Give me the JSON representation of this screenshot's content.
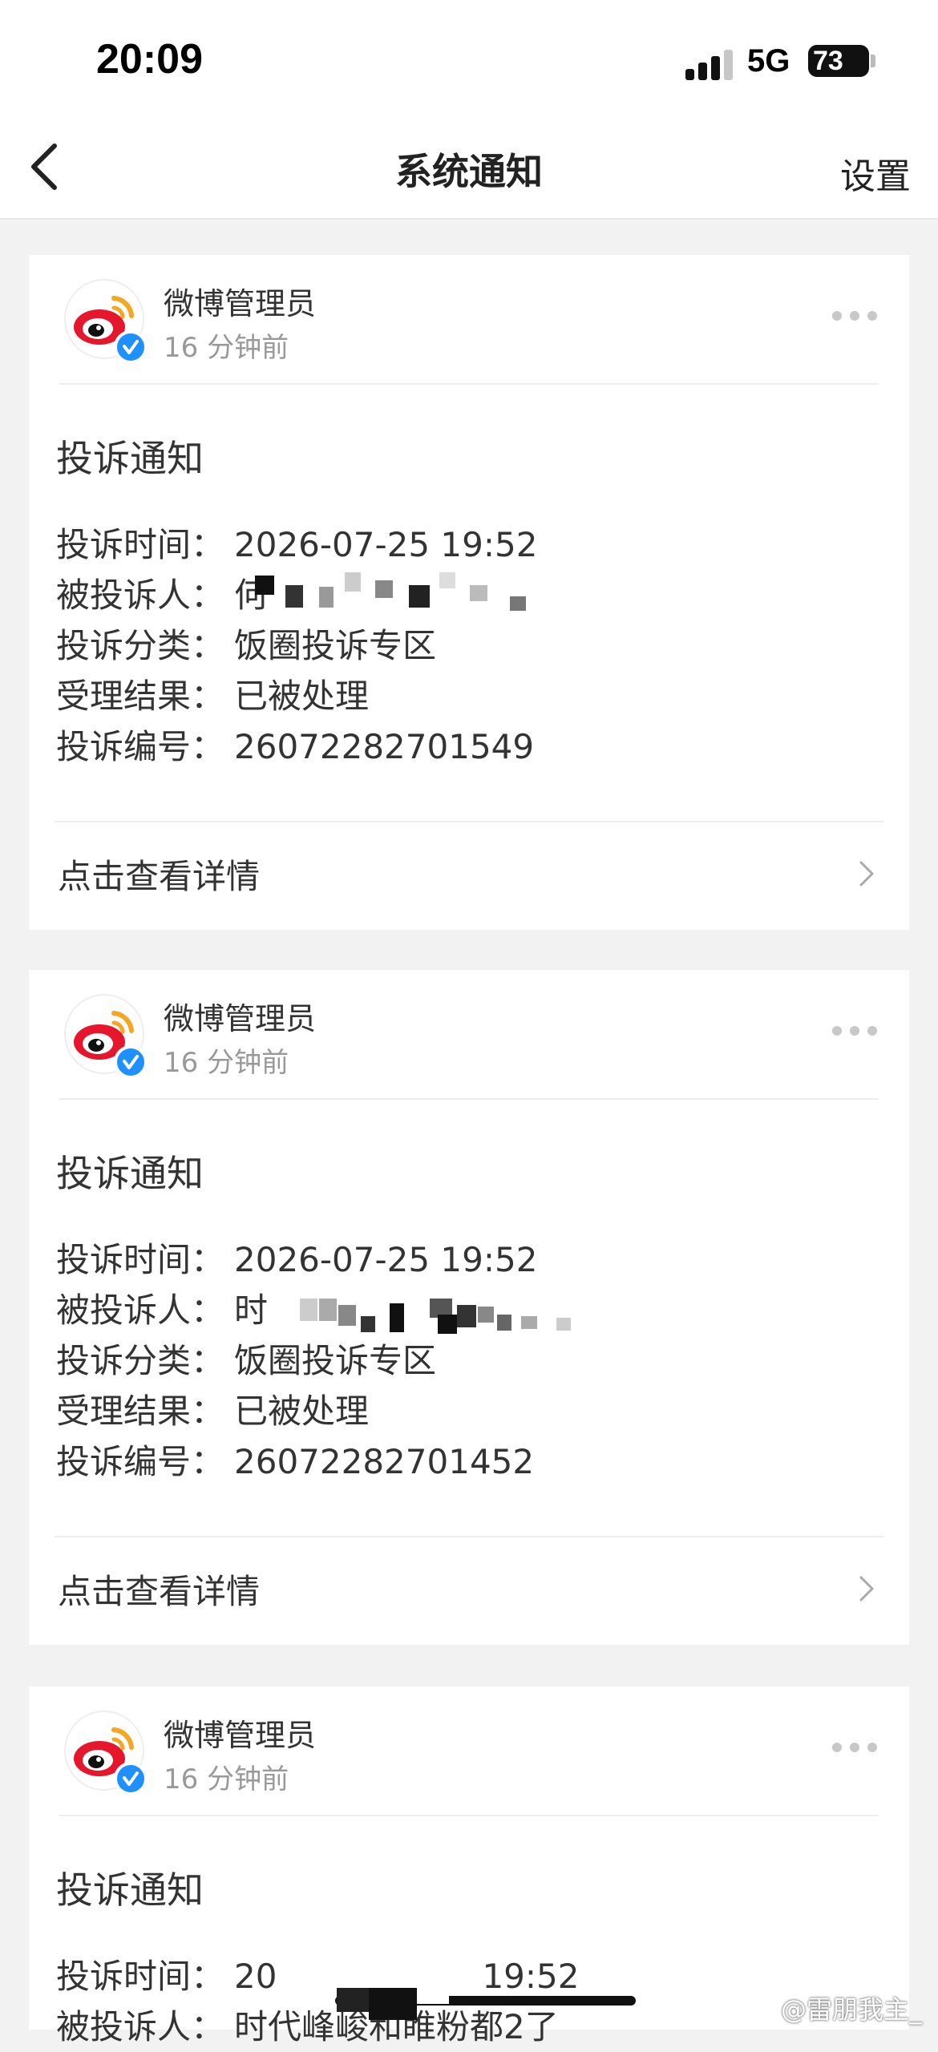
{
  "status_bar": {
    "time": "20:09",
    "network": "5G",
    "battery": "73"
  },
  "nav": {
    "title": "系统通知",
    "right": "设置"
  },
  "notifications": [
    {
      "sender": "微博管理员",
      "ago": "16 分钟前",
      "title": "投诉通知",
      "rows": [
        {
          "label": "投诉时间：",
          "value": "2026-07-25 19:52"
        },
        {
          "label": "被投诉人：",
          "value": "何"
        },
        {
          "label": "投诉分类：",
          "value": "饭圈投诉专区"
        },
        {
          "label": "受理结果：",
          "value": "已被处理"
        },
        {
          "label": "投诉编号：",
          "value": "26072282701549"
        }
      ],
      "detail": "点击查看详情"
    },
    {
      "sender": "微博管理员",
      "ago": "16 分钟前",
      "title": "投诉通知",
      "rows": [
        {
          "label": "投诉时间：",
          "value": "2026-07-25 19:52"
        },
        {
          "label": "被投诉人：",
          "value": "时"
        },
        {
          "label": "投诉分类：",
          "value": "饭圈投诉专区"
        },
        {
          "label": "受理结果：",
          "value": "已被处理"
        },
        {
          "label": "投诉编号：",
          "value": "26072282701452"
        }
      ],
      "detail": "点击查看详情"
    },
    {
      "sender": "微博管理员",
      "ago": "16 分钟前",
      "title": "投诉通知",
      "rows": [
        {
          "label": "投诉时间：",
          "value": "20"
        },
        {
          "label": "被投诉人：",
          "value": "时代峰峻和睢粉都2了"
        }
      ],
      "row1_tail": "19:52"
    }
  ],
  "watermark": "@雷朋我主_",
  "icons": {
    "back": "chevron-left-icon",
    "more": "more-dots-icon",
    "detail": "chevron-right-icon",
    "avatar": "weibo-logo-icon",
    "verified": "verified-badge-icon"
  }
}
